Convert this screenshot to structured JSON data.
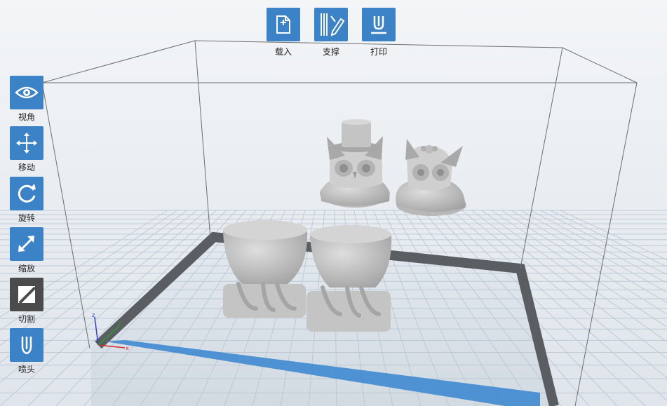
{
  "top_toolbar": {
    "load_label": "载入",
    "support_label": "支撑",
    "print_label": "打印"
  },
  "left_toolbar": {
    "view_label": "视角",
    "move_label": "移动",
    "rotate_label": "旋转",
    "scale_label": "缩放",
    "cut_label": "切割",
    "nozzle_label": "喷头"
  },
  "axes": {
    "x_label": "x",
    "y_label": "y",
    "z_label": "z"
  },
  "colors": {
    "button_blue": "#3b82c6",
    "button_dark": "#4b4b4b",
    "model_gray": "#c9c9c9",
    "plate_border": "#5a5e63",
    "front_edge_blue": "#3f8ad0"
  },
  "models": [
    {
      "name": "owl-with-top-hat"
    },
    {
      "name": "owl-with-bow"
    },
    {
      "name": "owl-body-left"
    },
    {
      "name": "owl-body-right"
    }
  ]
}
